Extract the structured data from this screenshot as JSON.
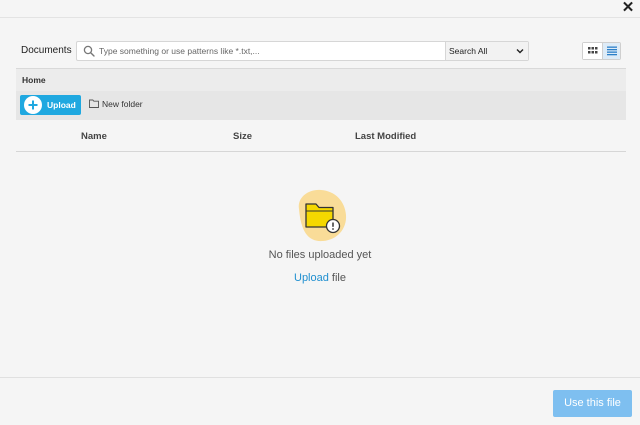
{
  "dialog": {
    "close_glyph": "✕"
  },
  "toolbar": {
    "documents_label": "Documents",
    "search_placeholder": "Type something or use patterns like *.txt,...",
    "search_value": "",
    "scope_value": "Search All",
    "scope_options": [
      "Search All"
    ],
    "view_mode": "list",
    "accent_color": "#1fa8e0"
  },
  "breadcrumb": {
    "items": [
      "Home"
    ]
  },
  "actions": {
    "upload_label": "Upload",
    "new_folder_label": "New folder"
  },
  "table": {
    "columns": [
      "Name",
      "Size",
      "Last Modified"
    ],
    "rows": []
  },
  "empty_state": {
    "message": "No files uploaded yet",
    "cta_link": "Upload",
    "cta_rest": " file",
    "icon": "folder-warning-icon"
  },
  "footer": {
    "use_file_label": "Use this file",
    "button_color": "#7ebff0"
  }
}
